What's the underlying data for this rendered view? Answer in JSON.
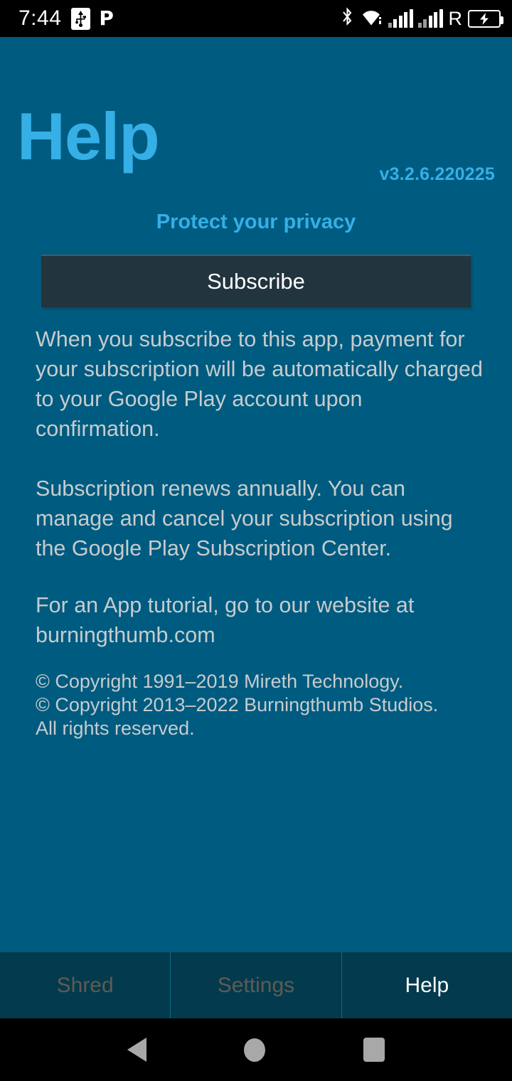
{
  "statusbar": {
    "clock": "7:44",
    "icons_left": [
      "usb-icon",
      "pandora-icon"
    ],
    "pandora_glyph": "P",
    "icons_right": [
      "bluetooth-icon",
      "wifi-icon",
      "signal-1-icon",
      "signal-2-icon",
      "roaming-icon",
      "battery-charging-icon"
    ],
    "roaming_label": "R",
    "bluetooth_glyph": "ᛦ",
    "battery_charging_glyph": "⚡"
  },
  "header": {
    "title": "Help",
    "version": "v3.2.6.220225",
    "title_color": "#35AFE6"
  },
  "main": {
    "privacy_heading": "Protect your privacy",
    "subscribe_label": "Subscribe",
    "paragraph_1": "When you subscribe to this app, payment for your subscription will be automatically charged to your Google Play account upon confirmation.",
    "paragraph_2": "Subscription renews annually. You can manage and cancel your subscription using the Google Play Subscription Center.",
    "paragraph_3": "For an App tutorial, go to our website at burningthumb.com",
    "copyright_line_1": "© Copyright 1991–2019 Mireth Technology.",
    "copyright_line_2": "© Copyright 2013–2022 Burningthumb Studios.",
    "copyright_line_3": "All rights reserved."
  },
  "tabbar": {
    "tabs": [
      {
        "label": "Shred",
        "active": false
      },
      {
        "label": "Settings",
        "active": false
      },
      {
        "label": "Help",
        "active": true
      }
    ]
  },
  "navbar": {
    "back": "back-button",
    "home": "home-button",
    "recents": "recents-button"
  },
  "colors": {
    "background": "#005B80",
    "accent": "#35AFE6",
    "body_text": "#C6CCCD",
    "button_bg": "#22343E",
    "tabbar_bg": "#033A4D",
    "tab_inactive": "#5F5B52",
    "tab_active": "#FFFFFF"
  }
}
